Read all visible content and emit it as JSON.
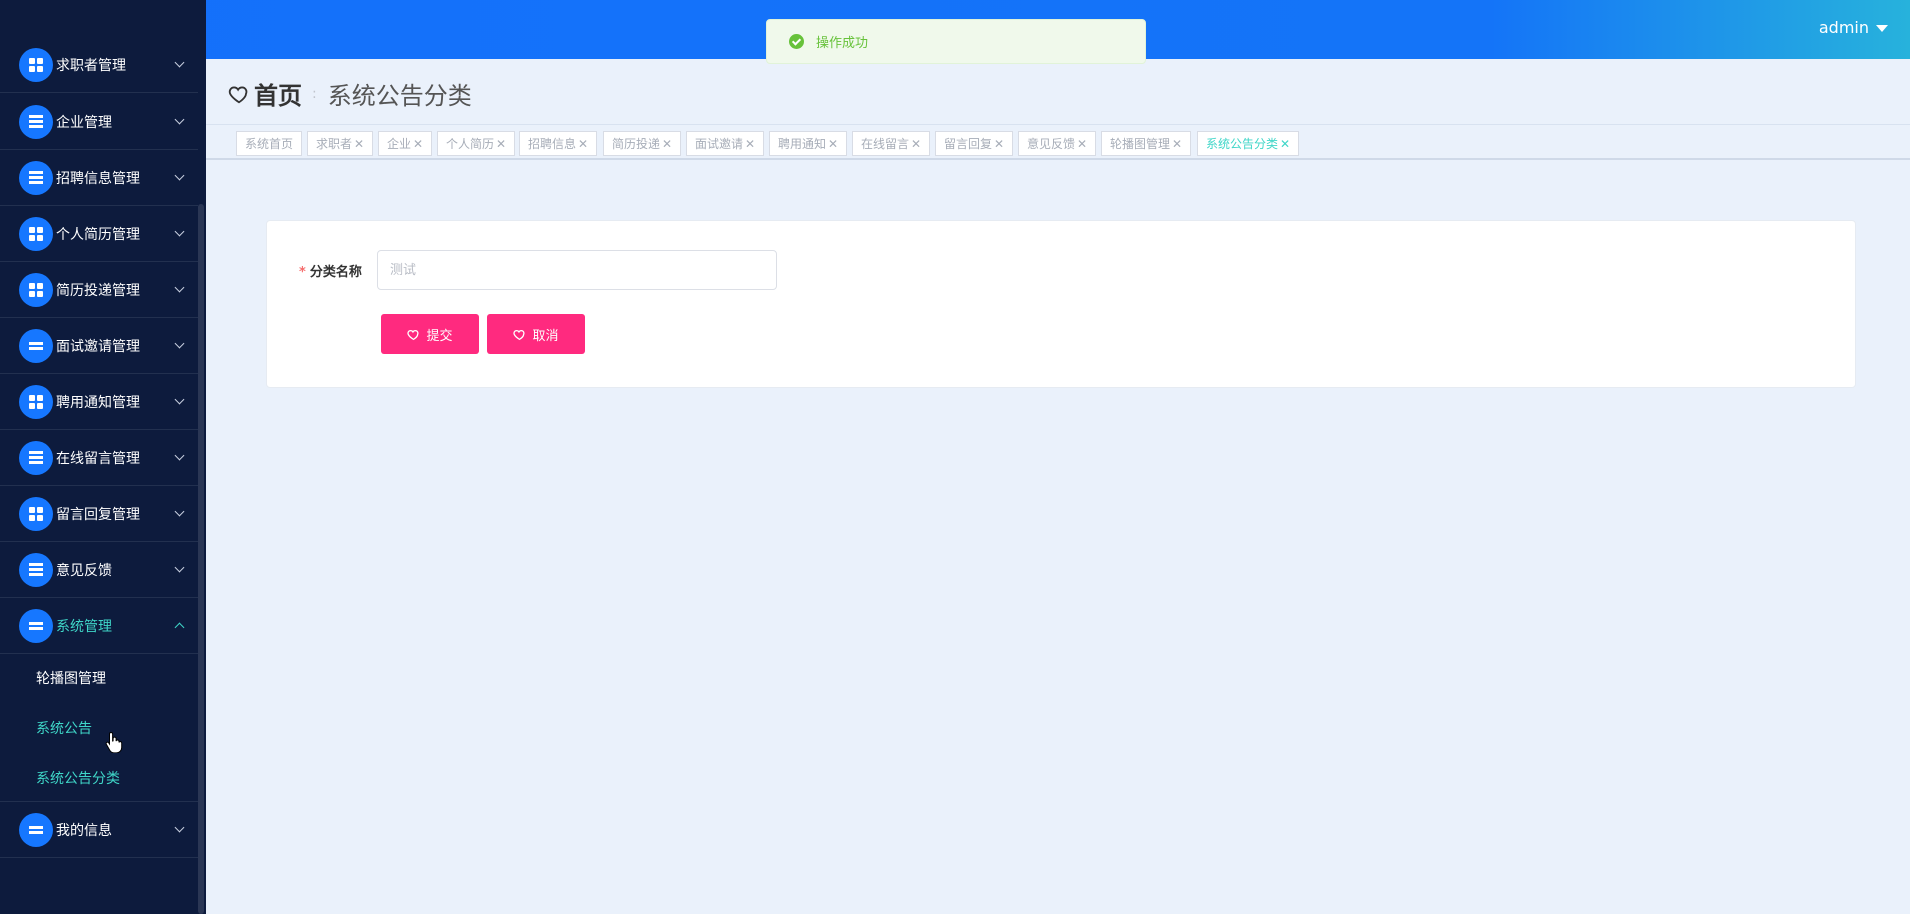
{
  "topbar": {
    "user_name": "admin"
  },
  "toast": {
    "message": "操作成功"
  },
  "sidebar": {
    "items": [
      {
        "label": "求职者管理",
        "icon": "grid-icon"
      },
      {
        "label": "企业管理",
        "icon": "sliders-icon"
      },
      {
        "label": "招聘信息管理",
        "icon": "list-icon"
      },
      {
        "label": "个人简历管理",
        "icon": "hand-icon"
      },
      {
        "label": "简历投递管理",
        "icon": "grid-icon"
      },
      {
        "label": "面试邀请管理",
        "icon": "chat-icon"
      },
      {
        "label": "聘用通知管理",
        "icon": "grid-icon"
      },
      {
        "label": "在线留言管理",
        "icon": "book-icon"
      },
      {
        "label": "留言回复管理",
        "icon": "grid-icon"
      },
      {
        "label": "意见反馈",
        "icon": "clipboard-icon"
      },
      {
        "label": "系统管理",
        "icon": "monitor-icon",
        "expanded": true
      },
      {
        "label": "我的信息",
        "icon": "card-icon"
      }
    ],
    "sub_items": [
      {
        "label": "轮播图管理"
      },
      {
        "label": "系统公告"
      },
      {
        "label": "系统公告分类"
      }
    ]
  },
  "breadcrumb": {
    "home": "首页",
    "separator": ":",
    "current": "系统公告分类"
  },
  "tags": [
    {
      "label": "系统首页",
      "closable": false
    },
    {
      "label": "求职者",
      "closable": true
    },
    {
      "label": "企业",
      "closable": true
    },
    {
      "label": "个人简历",
      "closable": true
    },
    {
      "label": "招聘信息",
      "closable": true
    },
    {
      "label": "简历投递",
      "closable": true
    },
    {
      "label": "面试邀请",
      "closable": true
    },
    {
      "label": "聘用通知",
      "closable": true
    },
    {
      "label": "在线留言",
      "closable": true
    },
    {
      "label": "留言回复",
      "closable": true
    },
    {
      "label": "意见反馈",
      "closable": true
    },
    {
      "label": "轮播图管理",
      "closable": true
    },
    {
      "label": "系统公告分类",
      "closable": true,
      "active": true
    }
  ],
  "form": {
    "required_mark": "*",
    "category_label": "分类名称",
    "category_placeholder": "测试",
    "category_value": "",
    "submit_label": "提交",
    "cancel_label": "取消"
  },
  "colors": {
    "topbar": "#1470fb",
    "sidebar": "#0d1b3d",
    "accent": "#3fd6c8",
    "button": "#ff2a7f",
    "success": "#67c23a"
  }
}
